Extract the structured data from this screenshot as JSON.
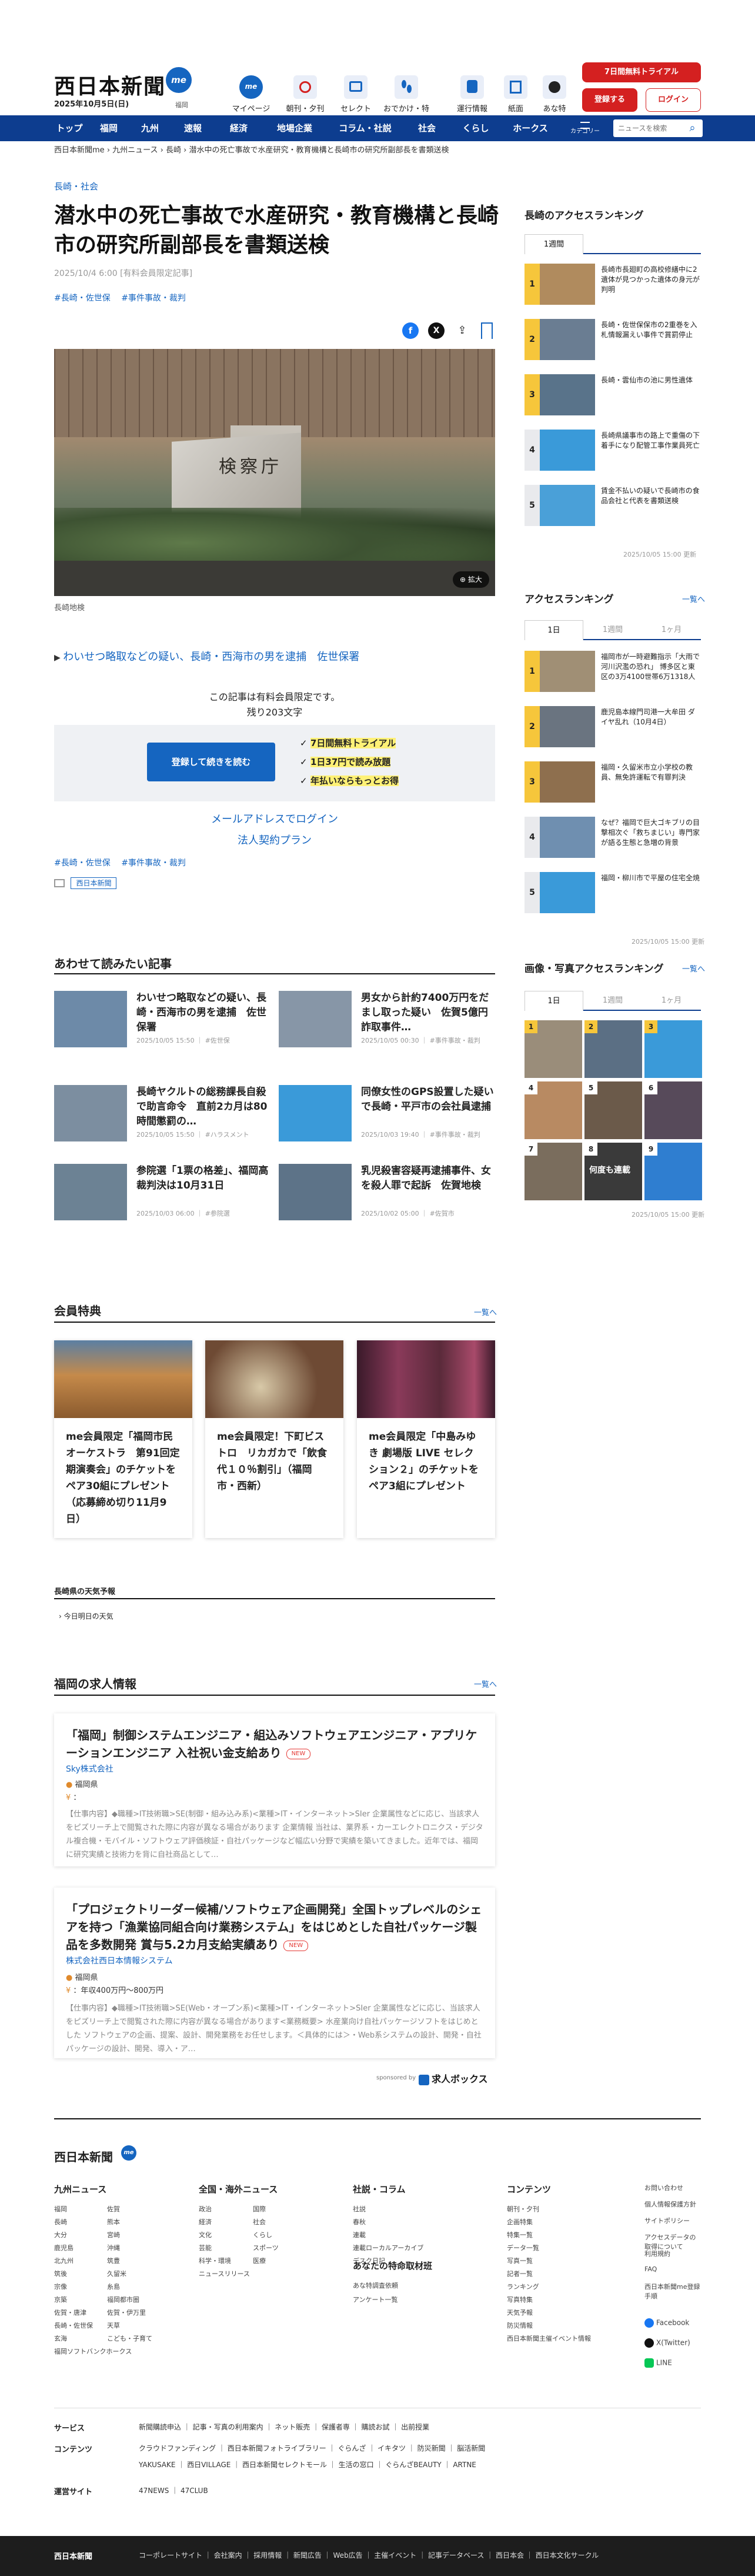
{
  "header": {
    "logo": "西日本新聞",
    "logo_badge": "me",
    "date": "2025年10月5日(日)",
    "region": "福岡",
    "nav_icons": [
      {
        "label": "マイページ",
        "icon": "me-icon"
      },
      {
        "label": "朝刊・夕刊",
        "icon": "newspaper-icon"
      },
      {
        "label": "セレクト",
        "icon": "select-icon"
      },
      {
        "label": "おでかけ・特典",
        "icon": "footprint-icon"
      },
      {
        "label": "運行情報",
        "icon": "train-icon"
      },
      {
        "label": "紙面",
        "icon": "paper-icon"
      },
      {
        "label": "あな特",
        "icon": "special-icon"
      }
    ],
    "trial_button": "7日間無料トライアル",
    "register_button": "登録する",
    "login_button": "ログイン"
  },
  "nav": {
    "items": [
      "トップ",
      "福岡",
      "九州",
      "速報",
      "経済",
      "地場企業",
      "コラム・社説",
      "社会",
      "くらし",
      "ホークス"
    ],
    "category_label": "カテゴリー",
    "search_placeholder": "ニュースを検索"
  },
  "breadcrumb": [
    "西日本新聞me",
    "九州ニュース",
    "長崎",
    "潜水中の死亡事故で水産研究・教育機構と長崎市の研究所副部長を書類送検"
  ],
  "article": {
    "category": "長崎・社会",
    "title": "潜水中の死亡事故で水産研究・教育機構と長崎市の研究所副部長を書類送検",
    "pubdate": "2025/10/4 6:00 [有料会員限定記事]",
    "tags": [
      "#長崎・佐世保",
      "#事件事故・裁判"
    ],
    "photo_caption": "長崎地検",
    "photo_inscription": "検察庁",
    "zoom_label": "拡大",
    "related_link": "わいせつ略取などの疑い、長崎・西海市の男を逮捕　佐世保署",
    "member_only_line1": "この記事は有料会員限定です。",
    "member_only_line2": "残り203文字",
    "readmore_button": "登録して続きを読む",
    "perks": [
      "7日間無料トライアル",
      "1日37円で読み放題",
      "年払いならもっとお得"
    ],
    "email_login": "メールアドレスでログイン",
    "corporate_plan": "法人契約プラン",
    "tags_bottom": [
      "#長崎・佐世保",
      "#事件事故・裁判"
    ],
    "print_label": "西日本新聞"
  },
  "related": {
    "title": "あわせて読みたい記事",
    "items": [
      {
        "title": "わいせつ略取などの疑い、長崎・西海市の男を逮捕　佐世保署",
        "meta": "2025/10/05 15:50 ｜ #佐世保",
        "color": "#6d8aa8"
      },
      {
        "title": "男女から計約7400万円をだまし取った疑い　佐賀5億円詐取事件…",
        "meta": "2025/10/05 00:30 ｜ #事件事故・裁判",
        "color": "#8796a7"
      },
      {
        "title": "長崎ヤクルトの総務課長自殺で助言命令　直前2カ月は80時間懲罰の…",
        "meta": "2025/10/05 15:50 ｜ #ハラスメント",
        "color": "#7c8ea0"
      },
      {
        "title": "同僚女性のGPS設置した疑いで長崎・平戸市の会社員逮捕",
        "meta": "2025/10/03 19:40 ｜ #事件事故・裁判",
        "color": "#3a9ad9"
      },
      {
        "title": "参院選「1票の格差」、福岡高裁判決は10月31日",
        "meta": "2025/10/03 06:00 ｜ #参院選",
        "color": "#6c8294"
      },
      {
        "title": "乳児殺害容疑再逮捕事件、女を殺人罪で起訴　佐賀地検",
        "meta": "2025/10/02 05:00 ｜ #佐賀市",
        "color": "#5d7388"
      }
    ]
  },
  "members": {
    "title": "会員特典",
    "more": "一覧へ",
    "cards": [
      {
        "title": "me会員限定「福岡市民オーケストラ　第91回定期演奏会」のチケットをペア30組にプレゼント（応募締め切り11月9日）",
        "color": "#8a5a2e"
      },
      {
        "title": "me会員限定！下町ビストロ　リカガカで「飲食代１０％割引」（福岡市・西新）",
        "color": "#6e4a34"
      },
      {
        "title": "me会員限定「中島みゆき 劇場版 LIVE セレクション２」のチケットをペア3組にプレゼント",
        "color": "#5a2a3a"
      }
    ]
  },
  "weather": {
    "title": "長崎県の天気予報",
    "tab": "今日明日の天気"
  },
  "jobs": {
    "title": "福岡の求人情報",
    "more": "一覧へ",
    "items": [
      {
        "title": "「福岡」制御システムエンジニア・組込みソフトウェアエンジニア・アプリケーションエンジニア 入社祝い金支給あり",
        "new": "NEW",
        "company": "Sky株式会社",
        "location": "福岡県",
        "salary": "：",
        "desc": "【仕事内容】◆職種>IT技術職>SE(制御・組み込み系)<業種>IT・インターネット>SIer 企業属性などに応じ、当該求人をピズリーチ上で閲覧された際に内容が異なる場合があります 企業情報 当社は、業界系・カーエレクトロニクス・デジタル複合機・モバイル・ソフトウェア評価検証・自社パッケージなど幅広い分野で実績を築いてきました。近年では、福岡に研究実績と技術力を背に自社商品として…"
      },
      {
        "title": "「プロジェクトリーダー候補/ソフトウェア企画開発」全国トップレベルのシェアを持つ「漁業協同組合向け業務システム」をはじめとした自社パッケージ製品を多数開発 賞与5.2カ月支給実績あり",
        "new": "NEW",
        "company": "株式会社西日本情報システム",
        "location": "福岡県",
        "salary": "：年収400万円〜800万円",
        "desc": "【仕事内容】◆職種>IT技術職>SE(Web・オープン系)<業種>IT・インターネット>SIer 企業属性などに応じ、当該求人をピズリーチ上で閲覧された際に内容が異なる場合があります<業務概要> 水産業向け自社パッケージソフトをはじめとした ソフトウェアの企画、提案、設計、開発業務をお任せします。＜具体的には＞・Web系システムの設計、開発・自社パッケージの設計、開発、導入・ア…"
      }
    ],
    "sponsor_label": "sponsored by",
    "sponsor": "求人ボックス"
  },
  "sidebar": {
    "access_ranking_title": "長崎のアクセスランキング",
    "access_tabs": [
      "1週間"
    ],
    "access_items": [
      {
        "rank": "1",
        "text": "長崎市長廻町の高校修繕中に2遺体が見つかった遺体の身元が判明",
        "color": "#b08b5e"
      },
      {
        "rank": "2",
        "text": "長崎・佐世保保市の2重巻を入札情報漏えい事件で賞罰停止",
        "color": "#6a7d92"
      },
      {
        "rank": "3",
        "text": "長崎・雲仙市の池に男性遺体",
        "color": "#59738a"
      },
      {
        "rank": "4",
        "text": "長崎県議事市の路上で重傷の下着手になり配管工事作業員死亡",
        "color": "#3a9ad9"
      },
      {
        "rank": "5",
        "text": "賃金不払いの疑いで長崎市の食品会社と代表を書類送検",
        "color": "#4aa0d8"
      }
    ],
    "access_updated": "2025/10/05 15:00 更新",
    "global_title": "アクセスランキング",
    "global_more": "一覧へ",
    "global_tabs": [
      "1日",
      "1週間",
      "1ヶ月"
    ],
    "global_items": [
      {
        "rank": "1",
        "text": "福岡市が一時避難指示「大雨で河川沢濫の恐れ」 博多区と東区の3万4100世帯6万1318人",
        "color": "#a08f75"
      },
      {
        "rank": "2",
        "text": "鹿児島本線門司港一大牟田 ダイヤ乱れ（10月4日）",
        "color": "#6a7480"
      },
      {
        "rank": "3",
        "text": "福岡・久留米市立小学校の教員、無免許運転で有罪判決",
        "color": "#8e6f4e"
      },
      {
        "rank": "4",
        "text": "なぜ？福岡で巨大ゴキブリの目撃相次ぐ「救ちまじい」専門家が語る生態と急増の背景",
        "color": "#6f8fb0"
      },
      {
        "rank": "5",
        "text": "福岡・柳川市で平屋の住宅全焼",
        "color": "#3a9ad9"
      }
    ],
    "global_updated": "2025/10/05 15:00 更新",
    "photo_title": "画像・写真アクセスランキング",
    "photo_more": "一覧へ",
    "photo_tabs": [
      "1日",
      "1週間",
      "1ヶ月"
    ],
    "photo_items": [
      {
        "rank": "1",
        "color": "#9a8d7a"
      },
      {
        "rank": "2",
        "color": "#5b6f84"
      },
      {
        "rank": "3",
        "color": "#3a9ad9"
      },
      {
        "rank": "4",
        "color": "#b88a62"
      },
      {
        "rank": "5",
        "color": "#6b5a4a"
      },
      {
        "rank": "6",
        "color": "#574a5a"
      },
      {
        "rank": "7",
        "color": "#7a6d5d"
      },
      {
        "rank": "8",
        "color": "#3a3a3a"
      },
      {
        "rank": "9",
        "color": "#2f7ed0"
      }
    ],
    "photo_label8": "何度も連載",
    "photo_updated": "2025/10/05 15:00 更新"
  },
  "footer": {
    "logo": "西日本新聞",
    "cols": [
      {
        "title": "九州ニュース",
        "items": [
          "福岡",
          "佐賀",
          "長崎",
          "熊本",
          "大分",
          "宮崎",
          "鹿児島",
          "沖縄",
          "北九州",
          "筑豊",
          "筑後",
          "久留米",
          "宗像",
          "糸島",
          "京築",
          "福岡都市圏",
          "佐賀・唐津",
          "佐賀・伊万里",
          "長崎・佐世保",
          "天草",
          "玄海",
          "こども・子育て",
          "福岡ソフトバンクホークス"
        ]
      },
      {
        "title": "全国・海外ニュース",
        "items": [
          "政治",
          "国際",
          "経済",
          "社会",
          "文化",
          "くらし",
          "芸能",
          "スポーツ",
          "科学・環境",
          "医療",
          "ニュースリリース"
        ]
      },
      {
        "title": "社説・コラム",
        "items": [
          "社説",
          "春秋",
          "連載",
          "連載ローカルアーカイブ",
          "デスク日記"
        ]
      },
      {
        "title": "コンテンツ",
        "items": [
          "朝刊・夕刊",
          "企画特集",
          "特集一覧",
          "データ一覧",
          "写真一覧",
          "記者一覧",
          "ランキング",
          "写真特集",
          "天気予報",
          "防災情報",
          "西日本新聞主催イベント情報"
        ]
      }
    ],
    "you_special_title": "あなたの特命取材班",
    "you_special_items": [
      "あな特調査依頼",
      "アンケート一覧"
    ],
    "misc": [
      "お問い合わせ",
      "個人情報保護方針",
      "サイトポリシー",
      "アクセスデータの取得について",
      "利用規約",
      "FAQ",
      "西日本新聞me登録手順"
    ],
    "social": [
      "Facebook",
      "X(Twitter)",
      "LINE"
    ],
    "rows": [
      {
        "label": "サービス",
        "links": "新聞購読申込 ｜ 記事・写真の利用案内 ｜ ネット販売 ｜ 保護者専 ｜ 購読お試 ｜ 出前授業"
      },
      {
        "label": "コンテンツ",
        "links": "クラウドファンディング ｜ 西日本新聞フォトライブラリー ｜ ぐらんざ ｜ イキタツ ｜ 防災新聞 ｜ 脳活新聞"
      },
      {
        "label": "",
        "links": "YAKUSAKE ｜ 西日VILLAGE ｜ 西日本新聞セレクトモール ｜ 生活の窓口 ｜ ぐらんざBEAUTY ｜ ARTNE"
      },
      {
        "label": "運営サイト",
        "links": "47NEWS ｜ 47CLUB"
      }
    ],
    "bottom_links": "コーポレートサイト ｜ 会社案内 ｜ 採用情報 ｜ 新聞広告 ｜ Web広告 ｜ 主催イベント ｜ 記事データベース ｜ 西日本会 ｜ 西日本文化サークル"
  },
  "colors": {
    "brand": "#0d3d8f",
    "accent": "#1565c0",
    "red": "#d42020"
  }
}
